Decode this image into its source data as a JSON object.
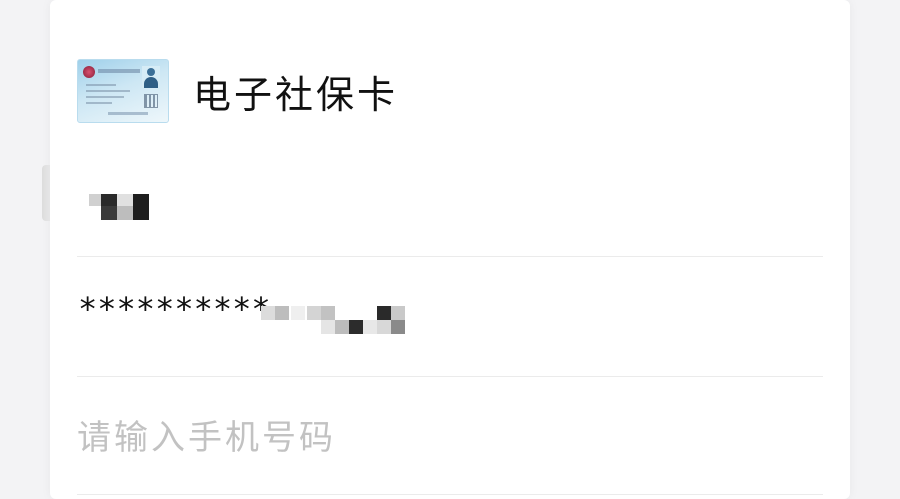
{
  "header": {
    "title": "电子社保卡",
    "icon": "social-security-card-icon"
  },
  "form": {
    "name_field": {
      "value_masked": true
    },
    "id_field": {
      "visible_prefix": "**********"
    },
    "phone_field": {
      "value": "",
      "placeholder": "请输入手机号码"
    }
  },
  "colors": {
    "card_bg": "#ffffff",
    "page_bg": "#f3f3f5",
    "text": "#111111",
    "placeholder": "#c2c2c2",
    "divider": "#ebebeb"
  }
}
